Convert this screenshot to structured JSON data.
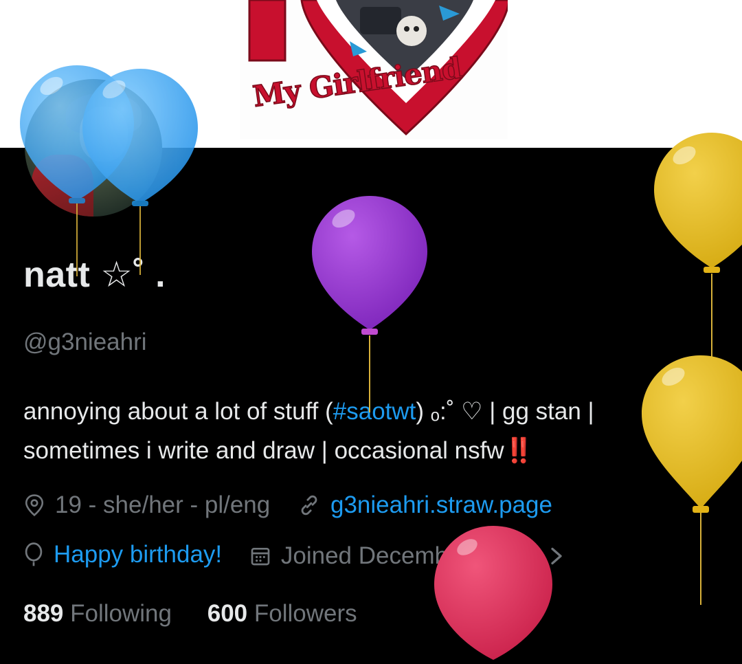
{
  "banner": {
    "caption": "My Girlfriend"
  },
  "profile": {
    "display_name": "natt ☆˚ .",
    "handle": "@g3nieahri",
    "bio": {
      "line1_pre": "annoying about a lot of stuff (",
      "hashtag": "#saotwt",
      "line1_post": ") ₒ:˚ ♡ | gg stan |",
      "line2_text": "sometimes i write and draw | occasional nsfw",
      "line2_emoji": "‼️"
    }
  },
  "meta": {
    "location": "19 - she/her - pl/eng",
    "website": "g3nieahri.straw.page",
    "birthday": "Happy birthday!",
    "joined": "Joined December 2021"
  },
  "stats": {
    "following_count": "889",
    "following_label": "Following",
    "followers_count": "600",
    "followers_label": "Followers"
  },
  "colors": {
    "accent": "#1d9bf0",
    "text_primary": "#e7e9ea",
    "text_secondary": "#71767b",
    "background": "#000000",
    "balloon_blue": "#3fa9f5",
    "balloon_purple": "#8b2fc9",
    "balloon_yellow": "#e6b91e",
    "balloon_red": "#e0305a"
  },
  "icons": [
    "location-pin-icon",
    "link-icon",
    "balloon-icon",
    "calendar-icon",
    "chevron-right-icon"
  ]
}
